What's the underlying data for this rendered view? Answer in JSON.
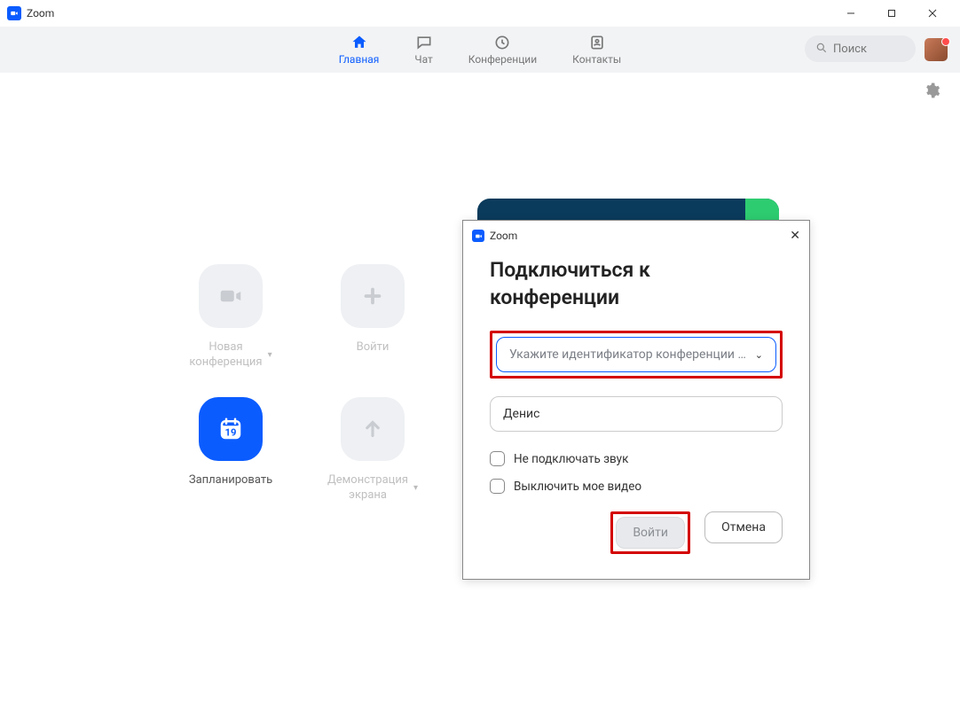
{
  "app": {
    "title": "Zoom"
  },
  "nav": {
    "tabs": [
      {
        "label": "Главная"
      },
      {
        "label": "Чат"
      },
      {
        "label": "Конференции"
      },
      {
        "label": "Контакты"
      }
    ],
    "search_placeholder": "Поиск"
  },
  "tiles": {
    "new_meeting": "Новая\nконференция",
    "join": "Войти",
    "schedule": "Запланировать",
    "schedule_day": "19",
    "share": "Демонстрация\nэкрана"
  },
  "dialog": {
    "title": "Zoom",
    "heading": "Подключиться к конференции",
    "id_placeholder": "Укажите идентификатор конференции …",
    "name_value": "Денис",
    "opt_no_audio": "Не подключать звук",
    "opt_no_video": "Выключить мое видео",
    "btn_join": "Войти",
    "btn_cancel": "Отмена"
  }
}
